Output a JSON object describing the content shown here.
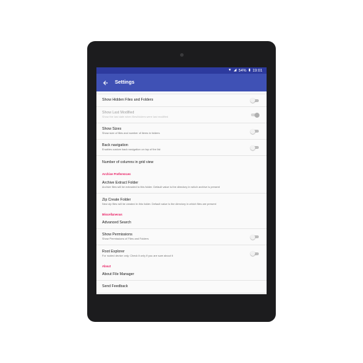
{
  "status_bar": {
    "battery": "54%",
    "time": "19:01"
  },
  "app_bar": {
    "title": "Settings"
  },
  "rows": {
    "show_hidden": {
      "title": "Show Hidden Files and Folders"
    },
    "show_last_modified": {
      "title": "Show Last Modified",
      "summary": "Show the last date when files/folders were last modified"
    },
    "show_sizes": {
      "title": "Show Sizes",
      "summary": "Show size of files and number of items in folders"
    },
    "back_navigation": {
      "title": "Back navigation",
      "summary": "Enables custom back navigation on top of the list"
    },
    "grid_columns": {
      "title": "Number of columns in grid view"
    },
    "archive_extract": {
      "title": "Archive Extract Folder",
      "summary": "Archive files will be extracted to this folder. Default value is the directory in which archive is present"
    },
    "zip_create": {
      "title": "Zip Create Folder",
      "summary": "New zip files will be created in this folder. Default value is the directory in which files are present"
    },
    "advanced_search": {
      "title": "Advanced Search"
    },
    "show_permissions": {
      "title": "Show Permissions",
      "summary": "Show Permissions of Files and Folders"
    },
    "root_explorer": {
      "title": "Root Explorer",
      "summary": "For rooted device only. Check it only if you are sure about it"
    },
    "about_app": {
      "title": "About File Manager"
    },
    "send_feedback": {
      "title": "Send Feedback"
    }
  },
  "categories": {
    "archive": "Archive Preferences",
    "misc": "Miscellaneous",
    "about": "About"
  },
  "colors": {
    "primary": "#3f51b5",
    "primary_dark": "#2d3a9e",
    "accent": "#e91e63"
  },
  "icons": {
    "back": "arrow-left-icon",
    "wifi": "wifi-icon",
    "signal": "signal-icon",
    "battery": "battery-icon"
  }
}
